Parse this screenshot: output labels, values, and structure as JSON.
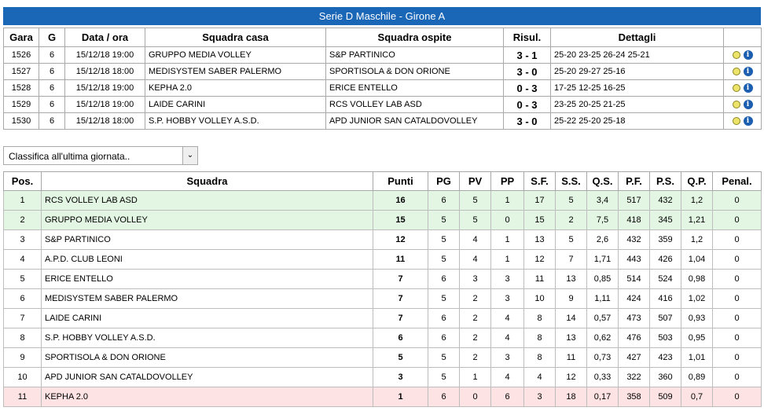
{
  "title": "Serie D Maschile - Girone A",
  "matches_headers": [
    "Gara",
    "G",
    "Data / ora",
    "Squadra casa",
    "Squadra ospite",
    "Risul.",
    "Dettagli",
    ""
  ],
  "matches": [
    {
      "gara": "1526",
      "g": "6",
      "data": "15/12/18 19:00",
      "casa": "GRUPPO MEDIA VOLLEY",
      "ospite": "S&P PARTINICO",
      "risul": "3 - 1",
      "dettagli": "25-20  23-25  26-24  25-21"
    },
    {
      "gara": "1527",
      "g": "6",
      "data": "15/12/18 18:00",
      "casa": "MEDISYSTEM SABER PALERMO",
      "ospite": "SPORTISOLA & DON ORIONE",
      "risul": "3 - 0",
      "dettagli": "25-20  29-27  25-16"
    },
    {
      "gara": "1528",
      "g": "6",
      "data": "15/12/18 19:00",
      "casa": "KEPHA 2.0",
      "ospite": "ERICE ENTELLO",
      "risul": "0 - 3",
      "dettagli": "17-25  12-25  16-25"
    },
    {
      "gara": "1529",
      "g": "6",
      "data": "15/12/18 19:00",
      "casa": "LAIDE CARINI",
      "ospite": "RCS VOLLEY LAB ASD",
      "risul": "0 - 3",
      "dettagli": "23-25  20-25  21-25"
    },
    {
      "gara": "1530",
      "g": "6",
      "data": "15/12/18 18:00",
      "casa": "S.P. HOBBY VOLLEY A.S.D.",
      "ospite": "APD JUNIOR SAN CATALDOVOLLEY",
      "risul": "3 - 0",
      "dettagli": "25-22  25-20  25-18"
    }
  ],
  "select": {
    "value": "Classifica all'ultima giornata.."
  },
  "standings_headers": [
    "Pos.",
    "Squadra",
    "Punti",
    "PG",
    "PV",
    "PP",
    "S.F.",
    "S.S.",
    "Q.S.",
    "P.F.",
    "P.S.",
    "Q.P.",
    "Penal."
  ],
  "standings": [
    {
      "pos": "1",
      "team": "RCS VOLLEY LAB ASD",
      "punti": "16",
      "pg": "6",
      "pv": "5",
      "pp": "1",
      "sf": "17",
      "ss": "5",
      "qs": "3,4",
      "pf": "517",
      "ps": "432",
      "qp": "1,2",
      "pen": "0",
      "zone": "green"
    },
    {
      "pos": "2",
      "team": "GRUPPO MEDIA VOLLEY",
      "punti": "15",
      "pg": "5",
      "pv": "5",
      "pp": "0",
      "sf": "15",
      "ss": "2",
      "qs": "7,5",
      "pf": "418",
      "ps": "345",
      "qp": "1,21",
      "pen": "0",
      "zone": "green"
    },
    {
      "pos": "3",
      "team": "S&P PARTINICO",
      "punti": "12",
      "pg": "5",
      "pv": "4",
      "pp": "1",
      "sf": "13",
      "ss": "5",
      "qs": "2,6",
      "pf": "432",
      "ps": "359",
      "qp": "1,2",
      "pen": "0",
      "zone": ""
    },
    {
      "pos": "4",
      "team": "A.P.D. CLUB LEONI",
      "punti": "11",
      "pg": "5",
      "pv": "4",
      "pp": "1",
      "sf": "12",
      "ss": "7",
      "qs": "1,71",
      "pf": "443",
      "ps": "426",
      "qp": "1,04",
      "pen": "0",
      "zone": ""
    },
    {
      "pos": "5",
      "team": "ERICE ENTELLO",
      "punti": "7",
      "pg": "6",
      "pv": "3",
      "pp": "3",
      "sf": "11",
      "ss": "13",
      "qs": "0,85",
      "pf": "514",
      "ps": "524",
      "qp": "0,98",
      "pen": "0",
      "zone": ""
    },
    {
      "pos": "6",
      "team": "MEDISYSTEM SABER PALERMO",
      "punti": "7",
      "pg": "5",
      "pv": "2",
      "pp": "3",
      "sf": "10",
      "ss": "9",
      "qs": "1,11",
      "pf": "424",
      "ps": "416",
      "qp": "1,02",
      "pen": "0",
      "zone": ""
    },
    {
      "pos": "7",
      "team": "LAIDE CARINI",
      "punti": "7",
      "pg": "6",
      "pv": "2",
      "pp": "4",
      "sf": "8",
      "ss": "14",
      "qs": "0,57",
      "pf": "473",
      "ps": "507",
      "qp": "0,93",
      "pen": "0",
      "zone": ""
    },
    {
      "pos": "8",
      "team": "S.P. HOBBY VOLLEY A.S.D.",
      "punti": "6",
      "pg": "6",
      "pv": "2",
      "pp": "4",
      "sf": "8",
      "ss": "13",
      "qs": "0,62",
      "pf": "476",
      "ps": "503",
      "qp": "0,95",
      "pen": "0",
      "zone": ""
    },
    {
      "pos": "9",
      "team": "SPORTISOLA & DON ORIONE",
      "punti": "5",
      "pg": "5",
      "pv": "2",
      "pp": "3",
      "sf": "8",
      "ss": "11",
      "qs": "0,73",
      "pf": "427",
      "ps": "423",
      "qp": "1,01",
      "pen": "0",
      "zone": ""
    },
    {
      "pos": "10",
      "team": "APD JUNIOR SAN CATALDOVOLLEY",
      "punti": "3",
      "pg": "5",
      "pv": "1",
      "pp": "4",
      "sf": "4",
      "ss": "12",
      "qs": "0,33",
      "pf": "322",
      "ps": "360",
      "qp": "0,89",
      "pen": "0",
      "zone": ""
    },
    {
      "pos": "11",
      "team": "KEPHA 2.0",
      "punti": "1",
      "pg": "6",
      "pv": "0",
      "pp": "6",
      "sf": "3",
      "ss": "18",
      "qs": "0,17",
      "pf": "358",
      "ps": "509",
      "qp": "0,7",
      "pen": "0",
      "zone": "red"
    }
  ],
  "colors": {
    "title_bar": "#1a66b7",
    "promotion_row": "#e3f6e3",
    "relegation_row": "#fde3e3"
  },
  "icons": [
    "ball-icon",
    "info-icon"
  ]
}
